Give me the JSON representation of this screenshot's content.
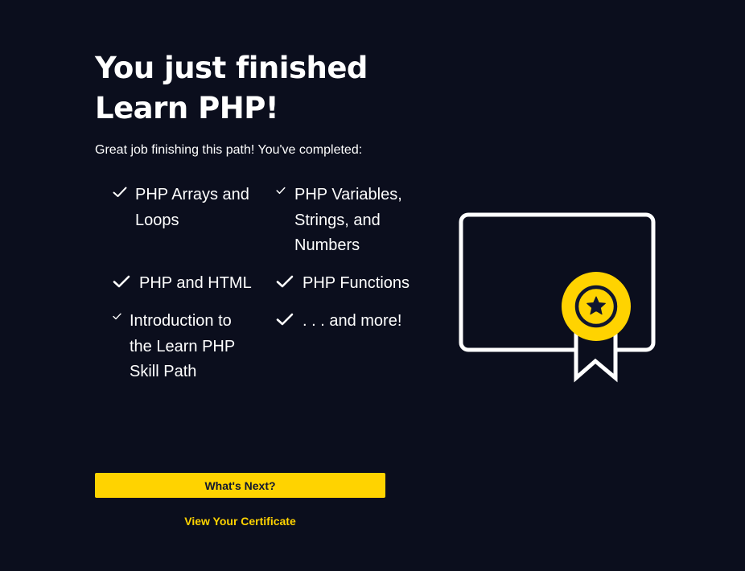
{
  "headline": {
    "line1": "You just finished",
    "line2": "Learn PHP!"
  },
  "subtitle": "Great job finishing this path! You've completed:",
  "courses": [
    {
      "label": "PHP Arrays and Loops",
      "icon": "checkmark-icon"
    },
    {
      "label": "PHP Variables, Strings, and Numbers",
      "icon": "checkmark-icon"
    },
    {
      "label": "PHP and HTML",
      "icon": "checkmark-icon"
    },
    {
      "label": "PHP Functions",
      "icon": "checkmark-icon"
    },
    {
      "label": "Introduction to the Learn PHP Skill Path",
      "icon": "checkmark-icon"
    },
    {
      "label": ". . . and more!",
      "icon": "checkmark-icon"
    }
  ],
  "illustration": {
    "icon": "certificate-award-icon"
  },
  "actions": {
    "next_label": "What's Next?",
    "certificate_label": "View Your Certificate"
  },
  "colors": {
    "background": "#0b0e1d",
    "accent": "#ffd300",
    "text": "#ffffff",
    "button_text": "#10162f"
  }
}
